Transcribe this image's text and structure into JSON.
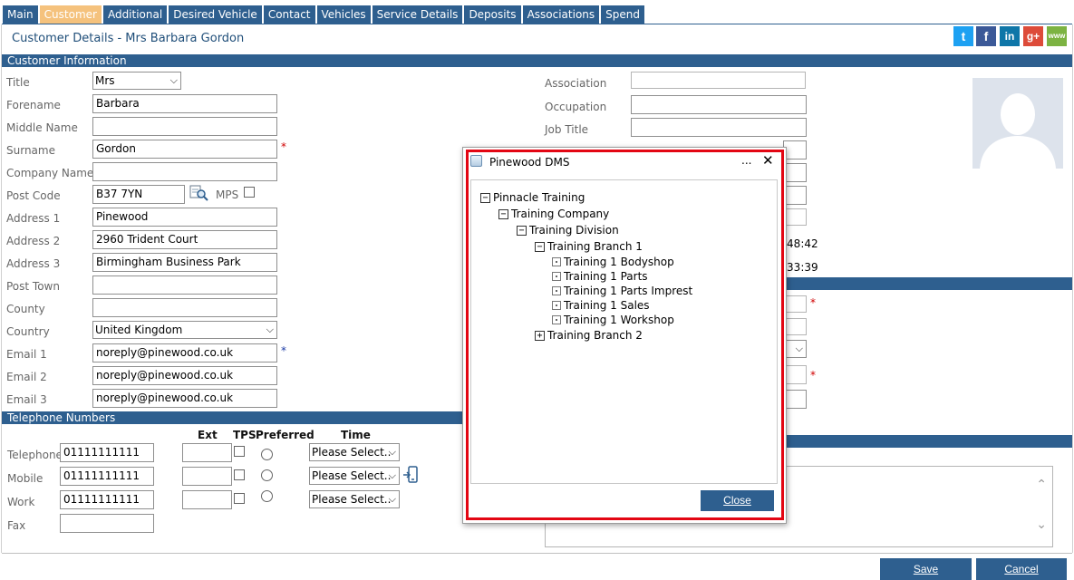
{
  "tabs": [
    "Main",
    "Customer",
    "Additional",
    "Desired Vehicle",
    "Contact",
    "Vehicles",
    "Service Details",
    "Deposits",
    "Associations",
    "Spend"
  ],
  "page_title": "Customer Details  -  Mrs Barbara Gordon",
  "social": {
    "twitter": "t",
    "facebook": "f",
    "linkedin": "in",
    "googleplus": "g+",
    "www": "www"
  },
  "sections": {
    "customer_info": "Customer Information",
    "telephone": "Telephone Numbers"
  },
  "customer": {
    "title_label": "Title",
    "title_value": "Mrs",
    "forename_label": "Forename",
    "forename_value": "Barbara",
    "middle_label": "Middle Name",
    "middle_value": "",
    "surname_label": "Surname",
    "surname_value": "Gordon",
    "company_label": "Company Name",
    "company_value": "",
    "postcode_label": "Post Code",
    "postcode_value": "B37 7YN",
    "mps_label": "MPS",
    "address1_label": "Address 1",
    "address1_value": "Pinewood",
    "address2_label": "Address 2",
    "address2_value": "2960 Trident Court",
    "address3_label": "Address 3",
    "address3_value": "Birmingham Business Park",
    "town_label": "Post Town",
    "town_value": "",
    "county_label": "County",
    "county_value": "",
    "country_label": "Country",
    "country_value": "United Kingdom",
    "email1_label": "Email 1",
    "email1_value": "noreply@pinewood.co.uk",
    "email2_label": "Email 2",
    "email2_value": "noreply@pinewood.co.uk",
    "email3_label": "Email 3",
    "email3_value": "noreply@pinewood.co.uk",
    "required_mark": "*"
  },
  "right_fields": {
    "association_label": "Association",
    "occupation_label": "Occupation",
    "jobtitle_label": "Job Title",
    "time1_fragment": ":48:42",
    "time2_fragment": ":33:39"
  },
  "phone": {
    "col_ext": "Ext",
    "col_tps": "TPS",
    "col_preferred": "Preferred",
    "col_time": "Time",
    "rows": [
      {
        "label": "Telephone",
        "number": "01111111111",
        "time": "Please Select.."
      },
      {
        "label": "Mobile",
        "number": "01111111111",
        "time": "Please Select.."
      },
      {
        "label": "Work",
        "number": "01111111111",
        "time": "Please Select.."
      },
      {
        "label": "Fax",
        "number": ""
      }
    ]
  },
  "modal": {
    "title": "Pinewood DMS",
    "more": "...",
    "close_x": "✕",
    "tree": {
      "root": "Pinnacle Training",
      "company": "Training Company",
      "division": "Training Division",
      "branch1": "Training Branch 1",
      "leaves": [
        "Training 1 Bodyshop",
        "Training 1 Parts",
        "Training 1 Parts Imprest",
        "Training 1 Sales",
        "Training 1 Workshop"
      ],
      "branch2": "Training Branch 2",
      "collapse_glyph": "−",
      "expand_glyph": "+"
    },
    "close_button": "Close"
  },
  "footer": {
    "save": "Save",
    "cancel": "Cancel"
  }
}
